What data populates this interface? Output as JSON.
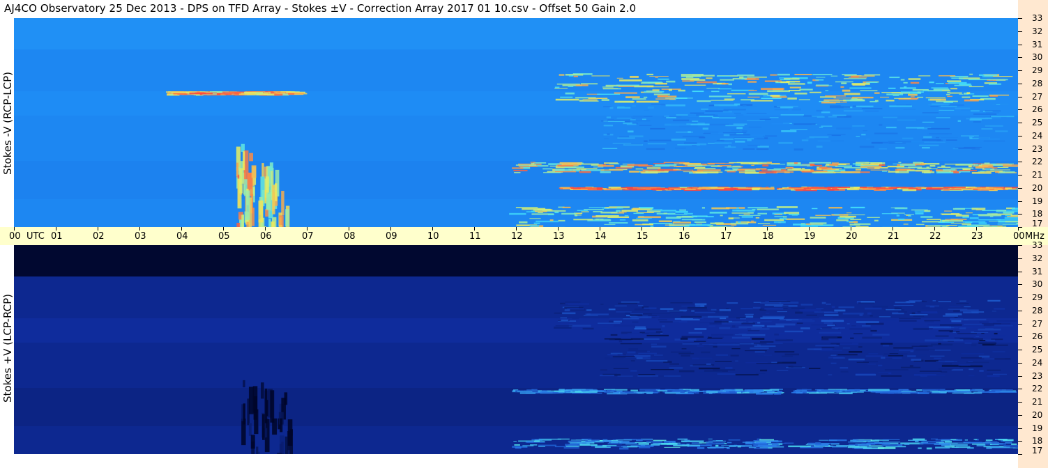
{
  "title": "AJ4CO Observatory  25 Dec 2013  -  DPS on TFD Array  -  Stokes ±V  -  Correction Array 2017 01 10.csv  -  Offset 50  Gain 2.0",
  "colors": {
    "right_axis_bg": "#ffe8d0",
    "time_band_bg": "#ffffcc",
    "top_panel_base": "#1f7fe8",
    "bottom_panel_base": "#0f2f9a",
    "burst_cyan": "#40e0ff",
    "burst_yellow": "#f4f060",
    "burst_red": "#ff4040"
  },
  "chart_data": [
    {
      "type": "heatmap",
      "panel": "top",
      "ylabel": "Stokes -V (RCP-LCP)",
      "x_unit_label": "UTC",
      "y_unit_label": "MHz",
      "xlim": [
        0,
        24
      ],
      "ylim": [
        17,
        33
      ],
      "x_ticks": [
        "00",
        "01",
        "02",
        "03",
        "04",
        "05",
        "06",
        "07",
        "08",
        "09",
        "10",
        "11",
        "12",
        "13",
        "14",
        "15",
        "16",
        "17",
        "18",
        "19",
        "20",
        "21",
        "22",
        "23",
        "00"
      ],
      "y_ticks": [
        "33",
        "32",
        "31",
        "30",
        "29",
        "28",
        "27",
        "26",
        "25",
        "24",
        "23",
        "22",
        "21",
        "20",
        "19",
        "18",
        "17"
      ],
      "colormap": "blue-cyan-yellow-red",
      "features": [
        {
          "kind": "band",
          "t0": 12.9,
          "t1": 23.5,
          "f0": 26.6,
          "f1": 28.8,
          "intensity": 0.75
        },
        {
          "kind": "band",
          "t0": 11.9,
          "t1": 23.7,
          "f0": 21.2,
          "f1": 22.0,
          "intensity": 0.8
        },
        {
          "kind": "band",
          "t0": 11.8,
          "t1": 24.0,
          "f0": 17.0,
          "f1": 18.6,
          "intensity": 0.7
        },
        {
          "kind": "band",
          "t0": 13.0,
          "t1": 23.7,
          "f0": 19.9,
          "f1": 20.1,
          "intensity": 0.95
        },
        {
          "kind": "band",
          "t0": 14.0,
          "t1": 23.5,
          "f0": 23.0,
          "f1": 26.5,
          "intensity": 0.35
        },
        {
          "kind": "band",
          "t0": 3.6,
          "t1": 6.5,
          "f0": 27.2,
          "f1": 27.4,
          "intensity": 0.85
        },
        {
          "kind": "burst",
          "t0": 5.3,
          "t1": 5.7,
          "f0": 17.0,
          "f1": 23.5,
          "intensity": 0.8
        },
        {
          "kind": "burst",
          "t0": 5.8,
          "t1": 6.5,
          "f0": 17.0,
          "f1": 22.0,
          "intensity": 0.75
        }
      ]
    },
    {
      "type": "heatmap",
      "panel": "bottom",
      "ylabel": "Stokes +V (LCP-RCP)",
      "y_unit_label": "MHz",
      "xlim": [
        0,
        24
      ],
      "ylim": [
        17,
        33
      ],
      "y_ticks": [
        "33",
        "32",
        "31",
        "30",
        "29",
        "28",
        "27",
        "26",
        "25",
        "24",
        "23",
        "22",
        "21",
        "20",
        "19",
        "18",
        "17"
      ],
      "colormap": "black-blue-cyan-yellow",
      "features": [
        {
          "kind": "band",
          "t0": 12.9,
          "t1": 23.5,
          "f0": 26.6,
          "f1": 28.8,
          "intensity": 0.35
        },
        {
          "kind": "band",
          "t0": 11.9,
          "t1": 23.7,
          "f0": 21.7,
          "f1": 22.0,
          "intensity": 0.6
        },
        {
          "kind": "band",
          "t0": 11.8,
          "t1": 24.0,
          "f0": 17.5,
          "f1": 18.2,
          "intensity": 0.65
        },
        {
          "kind": "band",
          "t0": 14.0,
          "t1": 23.5,
          "f0": 23.0,
          "f1": 26.5,
          "intensity": 0.25
        },
        {
          "kind": "burst",
          "t0": 5.3,
          "t1": 6.6,
          "f0": 17.0,
          "f1": 23.0,
          "intensity": 0.05
        }
      ]
    }
  ]
}
